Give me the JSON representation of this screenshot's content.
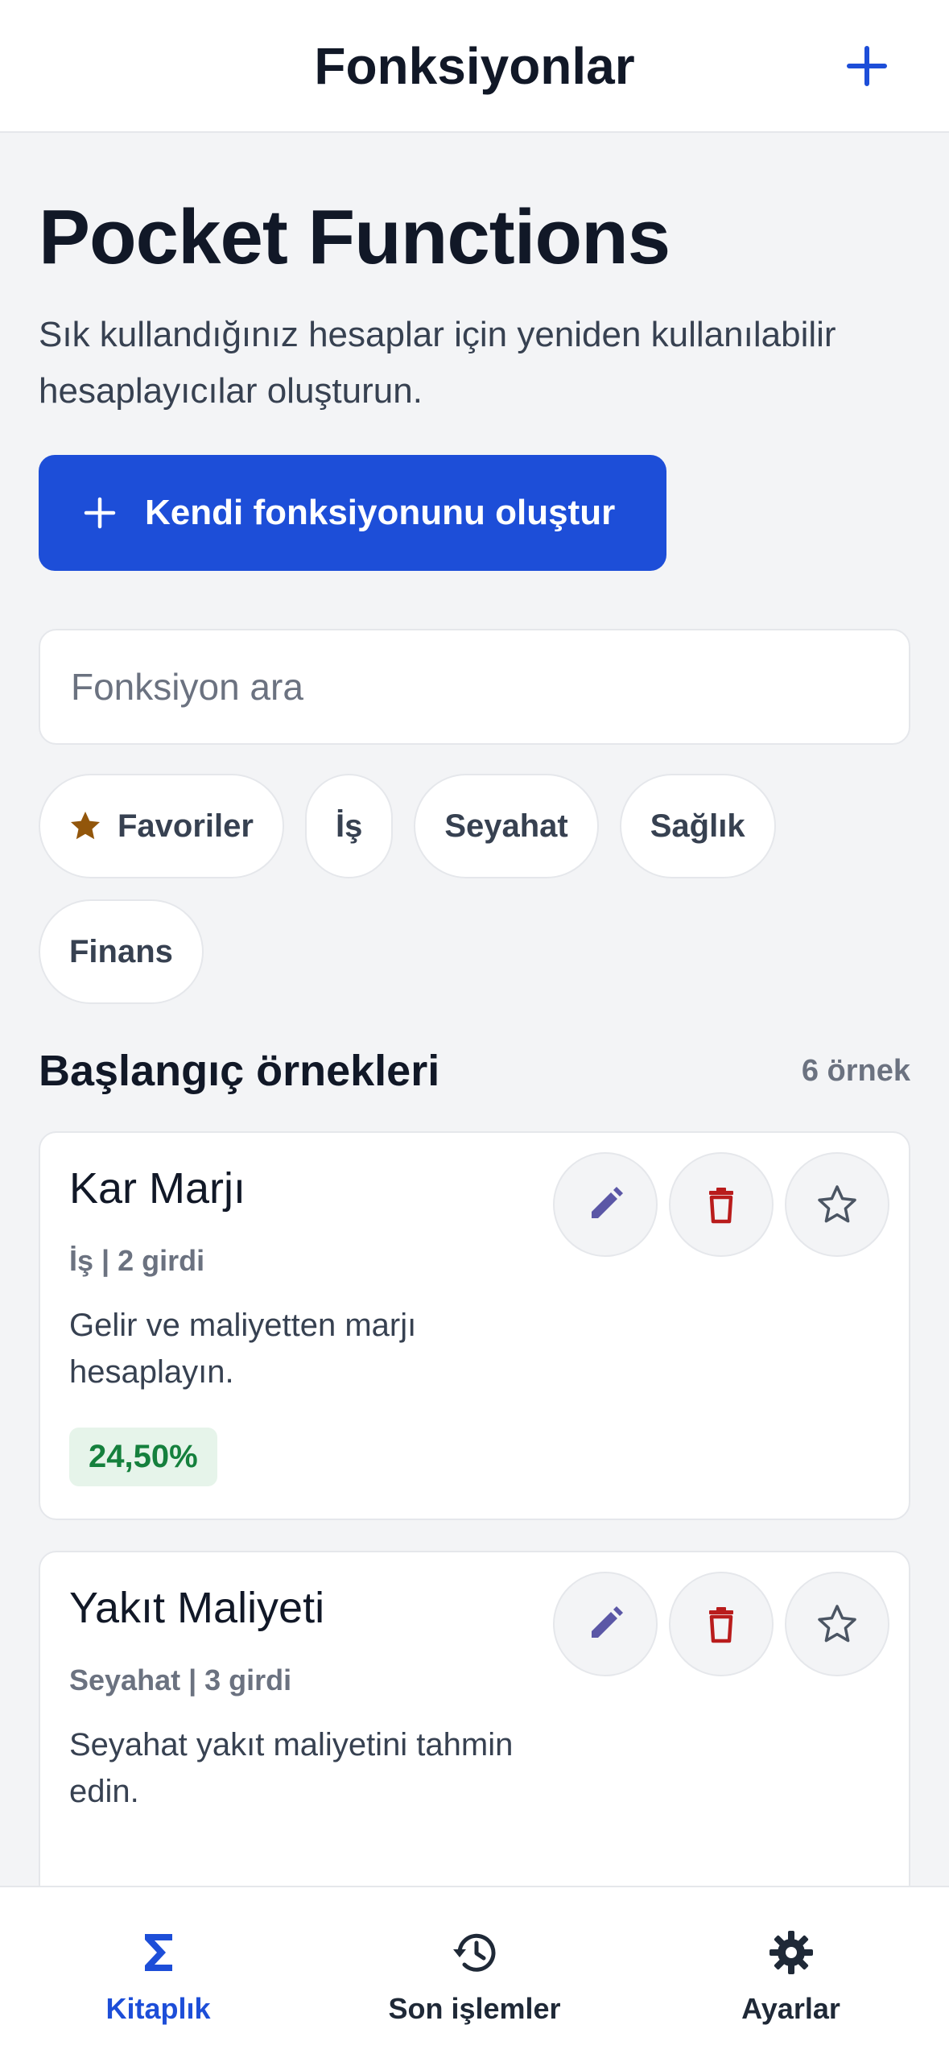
{
  "topbar": {
    "title": "Fonksiyonlar",
    "add_icon": "plus-icon"
  },
  "hero": {
    "title": "Pocket Functions",
    "subtitle": "Sık kullandığınız hesaplar için yeniden kullanılabilir hesaplayıcılar oluşturun."
  },
  "create_button": {
    "label": "Kendi fonksiyonunu oluştur"
  },
  "search": {
    "value": "",
    "placeholder": "Fonksiyon ara"
  },
  "chips": [
    {
      "label": "Favoriler",
      "icon": "star-icon",
      "color": "#92560b"
    },
    {
      "label": "İş"
    },
    {
      "label": "Seyahat"
    },
    {
      "label": "Sağlık"
    },
    {
      "label": "Finans"
    }
  ],
  "section": {
    "title": "Başlangıç örnekleri",
    "count": "6 örnek"
  },
  "cards": [
    {
      "title": "Kar Marjı",
      "meta": "İş | 2 girdi",
      "description": "Gelir ve maliyetten marjı hesaplayın.",
      "result": "24,50%"
    },
    {
      "title": "Yakıt Maliyeti",
      "meta": "Seyahat | 3 girdi",
      "description": "Seyahat yakıt maliyetini tahmin edin."
    }
  ],
  "tabs": [
    {
      "label": "Kitaplık",
      "icon": "sigma-icon",
      "active": true
    },
    {
      "label": "Son işlemler",
      "icon": "history-icon",
      "active": false
    },
    {
      "label": "Ayarlar",
      "icon": "gear-icon",
      "active": false
    }
  ],
  "colors": {
    "accent": "#1d4ed8",
    "edit_icon": "#5b57a6",
    "delete_icon": "#b91c1c",
    "star_icon": "#4b5563",
    "result_bg": "#e6f4ea",
    "result_text": "#15803d"
  }
}
